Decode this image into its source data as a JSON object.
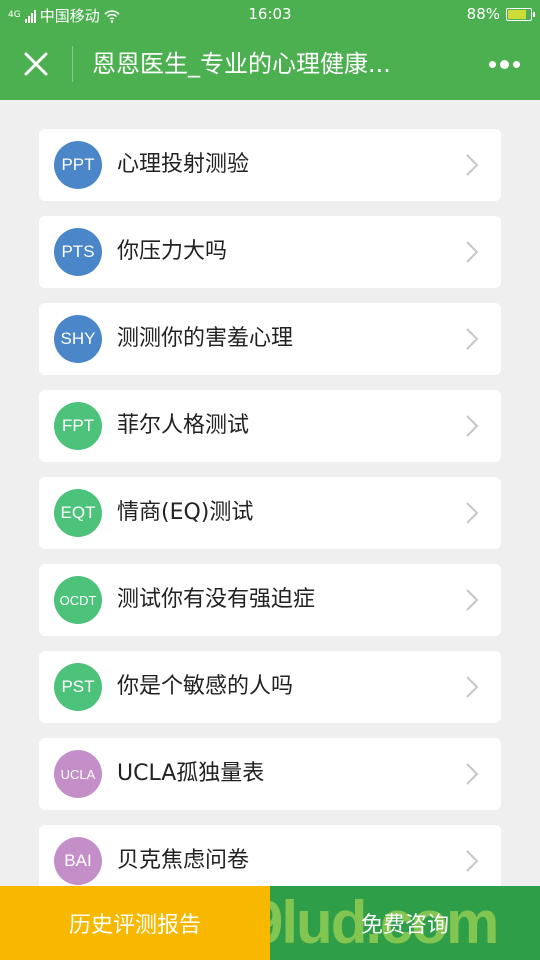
{
  "status_bar": {
    "network_type": "4G",
    "carrier": "中国移动",
    "time": "16:03",
    "battery": "88%",
    "battery_level": 0.88
  },
  "nav": {
    "title": "恩恩医生_专业的心理健康..."
  },
  "tests": [
    {
      "badge": "PPT",
      "label": "心理投射测验",
      "color": "#4a86c8"
    },
    {
      "badge": "PTS",
      "label": "你压力大吗",
      "color": "#4a86c8"
    },
    {
      "badge": "SHY",
      "label": "测测你的害羞心理",
      "color": "#4a86c8"
    },
    {
      "badge": "FPT",
      "label": "菲尔人格测试",
      "color": "#4dc27a"
    },
    {
      "badge": "EQT",
      "label": "情商(EQ)测试",
      "color": "#4dc27a"
    },
    {
      "badge": "OCDT",
      "label": "测试你有没有强迫症",
      "color": "#4dc27a"
    },
    {
      "badge": "PST",
      "label": "你是个敏感的人吗",
      "color": "#4dc27a"
    },
    {
      "badge": "UCLA",
      "label": "UCLA孤独量表",
      "color": "#c48fc8"
    },
    {
      "badge": "BAI",
      "label": "贝克焦虑问卷",
      "color": "#c48fc8"
    }
  ],
  "bottom": {
    "history_label": "历史评测报告",
    "consult_label": "免费咨询",
    "watermark": "9lud.com"
  }
}
